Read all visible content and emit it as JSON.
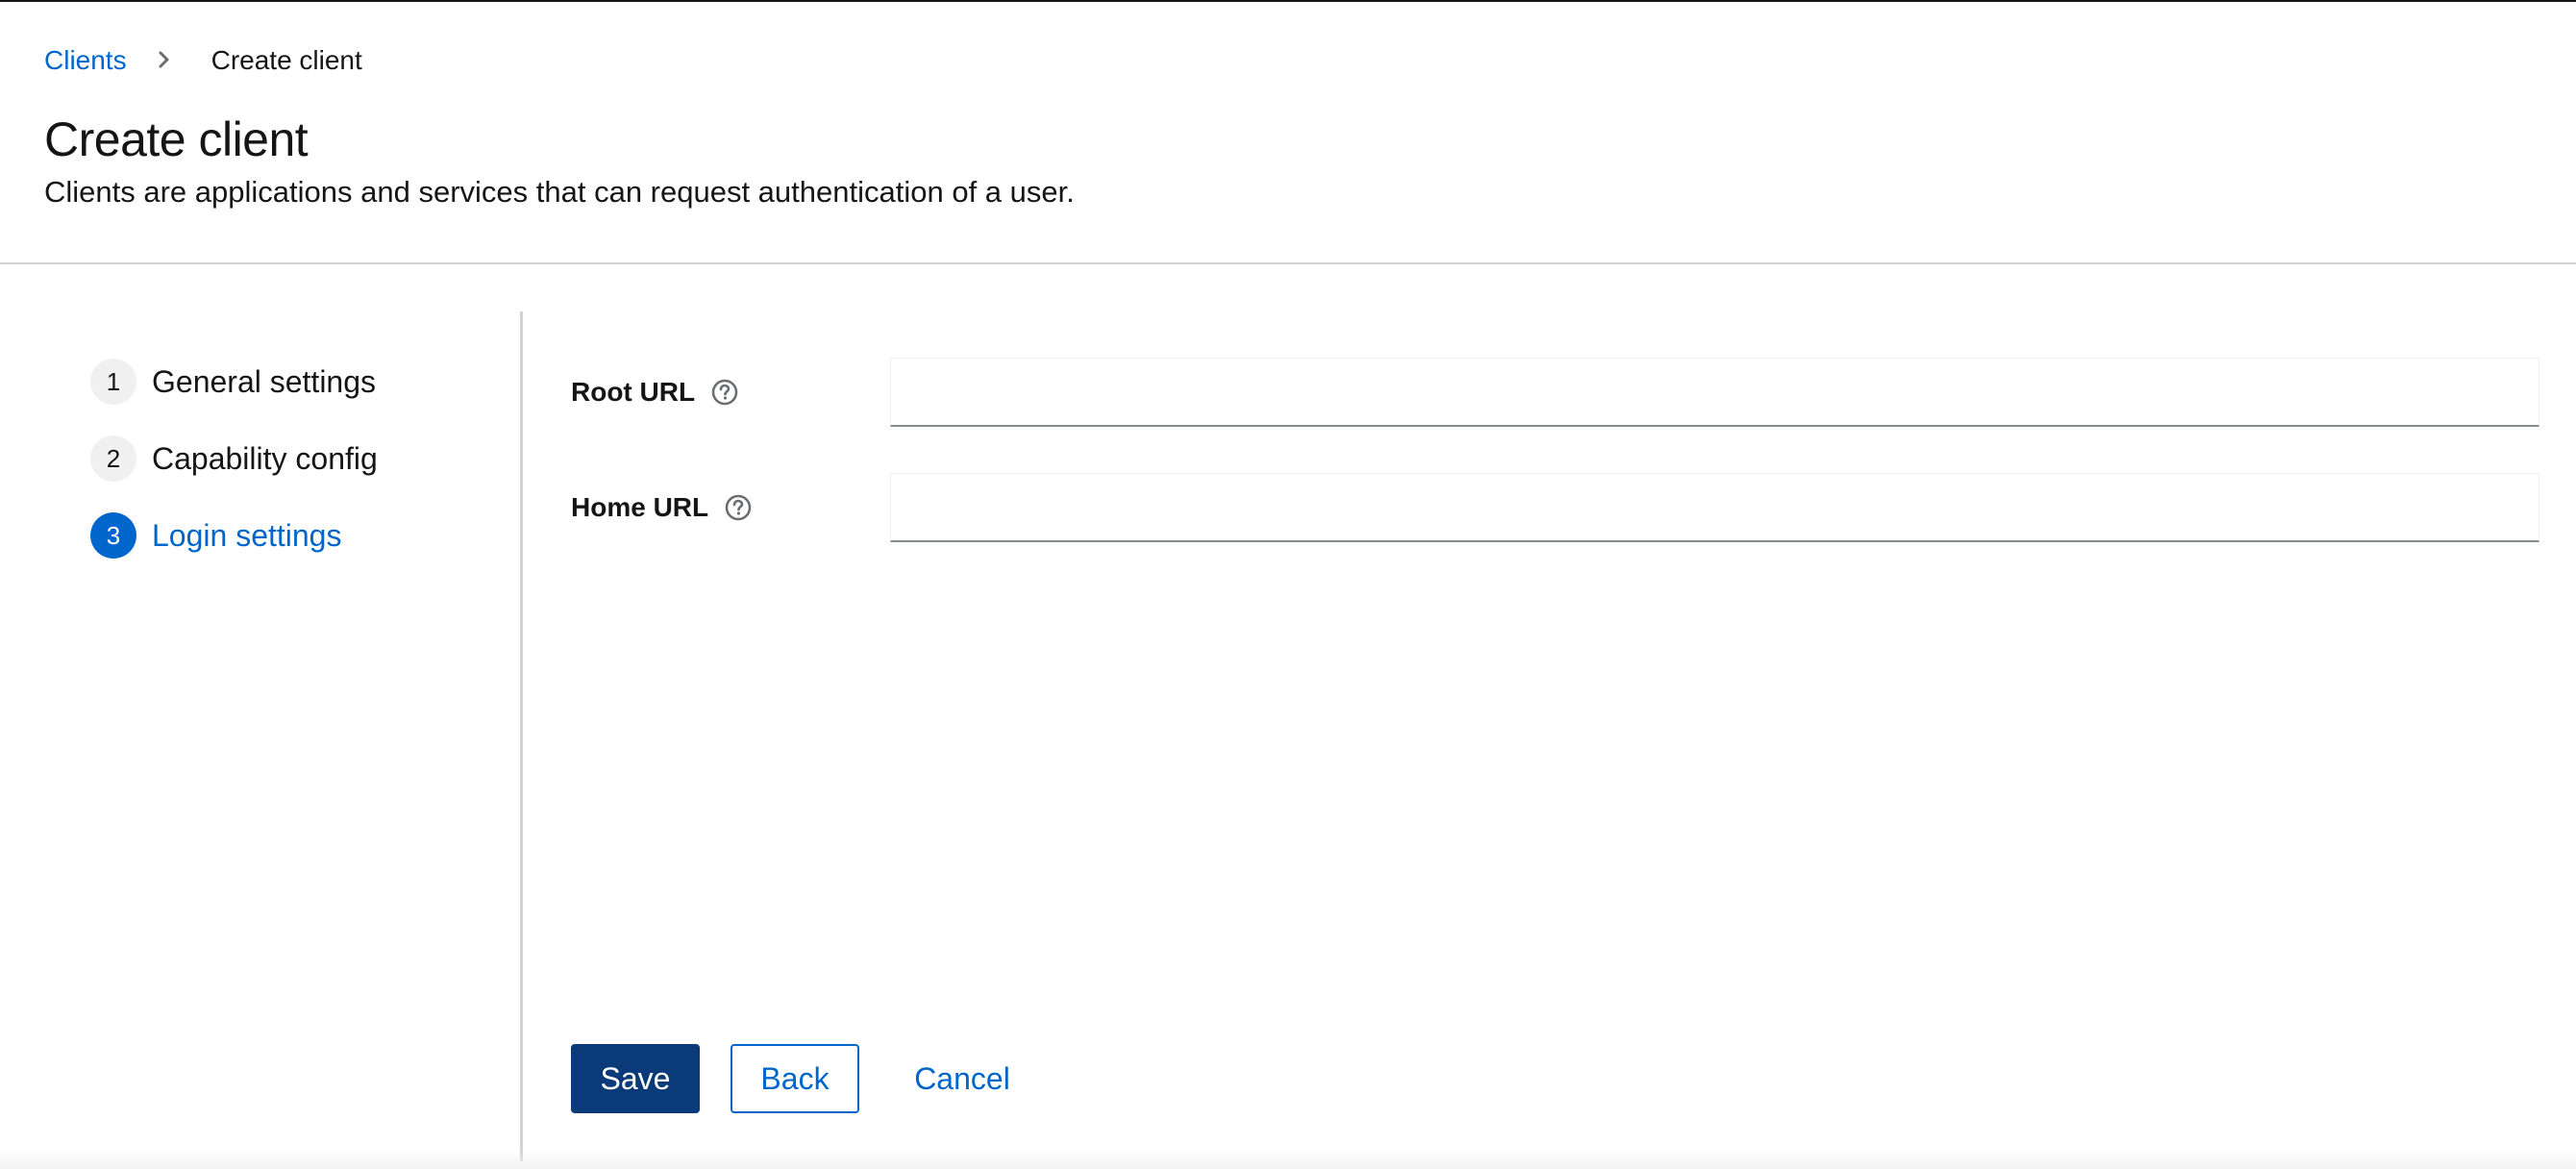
{
  "breadcrumb": {
    "parent": "Clients",
    "current": "Create client"
  },
  "header": {
    "title": "Create client",
    "description": "Clients are applications and services that can request authentication of a user."
  },
  "wizard": {
    "steps": [
      {
        "number": "1",
        "label": "General settings",
        "active": false
      },
      {
        "number": "2",
        "label": "Capability config",
        "active": false
      },
      {
        "number": "3",
        "label": "Login settings",
        "active": true
      }
    ]
  },
  "form": {
    "root_url": {
      "label": "Root URL",
      "value": "",
      "placeholder": ""
    },
    "home_url": {
      "label": "Home URL",
      "value": "",
      "placeholder": ""
    }
  },
  "actions": {
    "save_label": "Save",
    "back_label": "Back",
    "cancel_label": "Cancel"
  },
  "icons": {
    "breadcrumb_separator": "chevron-right-icon",
    "help": "question-circle-icon"
  },
  "colors": {
    "link": "#0066cc",
    "primary_button": "#0b3a7a",
    "active_step": "#0066cc"
  }
}
